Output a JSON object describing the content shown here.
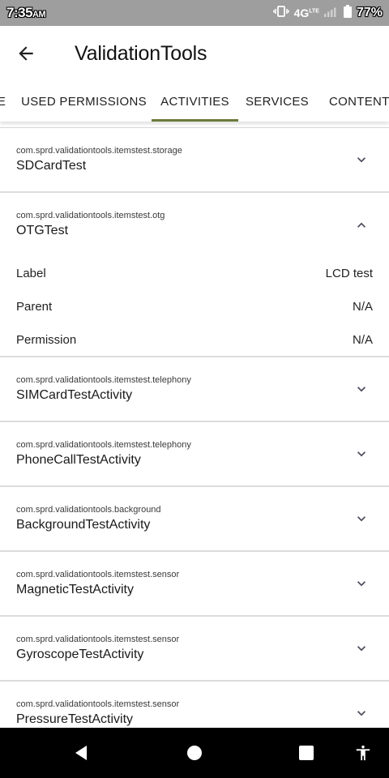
{
  "status_bar": {
    "time": "7:35",
    "ampm": "AM",
    "network": "4G",
    "network_sup": "LTE",
    "battery": "77%"
  },
  "app_bar": {
    "back_icon": "arrow-back-icon",
    "title": "ValidationTools"
  },
  "tabs": [
    {
      "label": "E"
    },
    {
      "label": "USED PERMISSIONS"
    },
    {
      "label": "ACTIVITIES",
      "selected": true
    },
    {
      "label": "SERVICES"
    },
    {
      "label": "CONTENT P"
    }
  ],
  "accent_color": "#6b7a3c",
  "activities": [
    {
      "package": "com.sprd.validationtools.itemstest.storage",
      "name": "SDCardTest",
      "expanded": false
    },
    {
      "package": "com.sprd.validationtools.itemstest.otg",
      "name": "OTGTest",
      "expanded": true,
      "details": [
        {
          "label": "Label",
          "value": "LCD test"
        },
        {
          "label": "Parent",
          "value": "N/A"
        },
        {
          "label": "Permission",
          "value": "N/A"
        }
      ]
    },
    {
      "package": "com.sprd.validationtools.itemstest.telephony",
      "name": "SIMCardTestActivity",
      "expanded": false
    },
    {
      "package": "com.sprd.validationtools.itemstest.telephony",
      "name": "PhoneCallTestActivity",
      "expanded": false
    },
    {
      "package": "com.sprd.validationtools.background",
      "name": "BackgroundTestActivity",
      "expanded": false
    },
    {
      "package": "com.sprd.validationtools.itemstest.sensor",
      "name": "MagneticTestActivity",
      "expanded": false
    },
    {
      "package": "com.sprd.validationtools.itemstest.sensor",
      "name": "GyroscopeTestActivity",
      "expanded": false
    },
    {
      "package": "com.sprd.validationtools.itemstest.sensor",
      "name": "PressureTestActivity",
      "expanded": false
    }
  ],
  "nav_bar": {
    "back": "nav-back-icon",
    "home": "nav-home-icon",
    "recents": "nav-recents-icon",
    "accessibility": "accessibility-icon"
  }
}
